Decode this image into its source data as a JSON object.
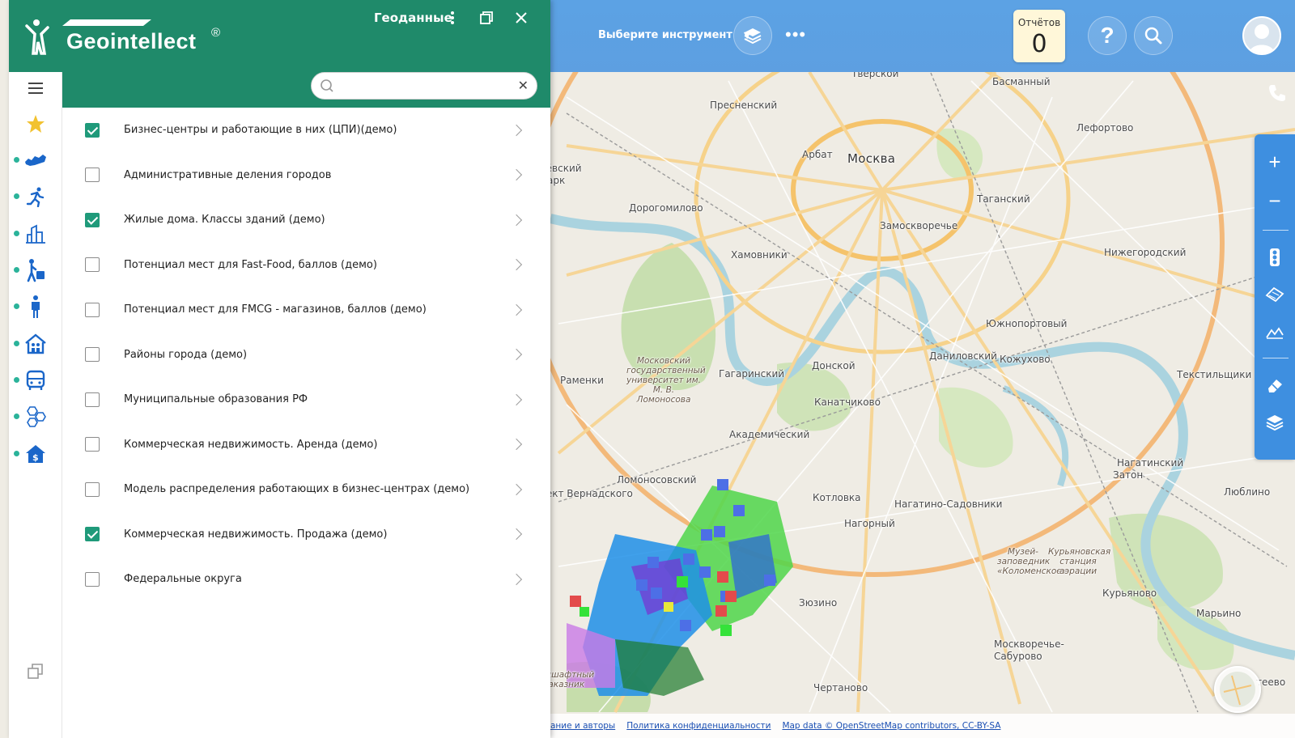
{
  "app": {
    "logo_text": "Geointellect",
    "registered_mark": "®"
  },
  "panel": {
    "title": "Геоданные",
    "search": {
      "placeholder": "",
      "value": ""
    },
    "layers": [
      {
        "label": "Бизнес-центры и работающие в них (ЦПИ)(демо)",
        "checked": true
      },
      {
        "label": "Административные деления городов",
        "checked": false
      },
      {
        "label": "Жилые дома. Классы зданий (демо)",
        "checked": true
      },
      {
        "label": "Потенциал мест для Fast-Food, баллов (демо)",
        "checked": false
      },
      {
        "label": "Потенциал мест для FMCG - магазинов, баллов (демо)",
        "checked": false
      },
      {
        "label": "Районы города (демо)",
        "checked": false
      },
      {
        "label": "Муниципальные образования РФ",
        "checked": false
      },
      {
        "label": "Коммерческая недвижимость. Аренда (демо)",
        "checked": false
      },
      {
        "label": "Модель распределения работающих в бизнес-центрах (демо)",
        "checked": false
      },
      {
        "label": "Коммерческая недвижимость. Продажа (демо)",
        "checked": true
      },
      {
        "label": "Федеральные округа",
        "checked": false
      }
    ],
    "rail_icons": [
      "menu-icon",
      "star-icon",
      "russia-map-icon",
      "running-person-icon",
      "city-buildings-icon",
      "traveler-luggage-icon",
      "standing-person-icon",
      "family-house-icon",
      "bus-icon",
      "hexagons-icon",
      "house-money-icon"
    ]
  },
  "topbar": {
    "tool_select": "Выберите инструмент",
    "reports_label": "Отчётов",
    "reports_count": "0",
    "help_glyph": "?"
  },
  "map": {
    "labels": [
      {
        "text": "Тверской",
        "kind": "district"
      },
      {
        "text": "Басманный",
        "kind": "district"
      },
      {
        "text": "Пресненский",
        "kind": "district"
      },
      {
        "text": "Лефортово",
        "kind": "district"
      },
      {
        "text": "Арбат",
        "kind": "district"
      },
      {
        "text": "Москва",
        "kind": "city"
      },
      {
        "text": "лёвский",
        "kind": "district"
      },
      {
        "text": "Парк",
        "kind": "district"
      },
      {
        "text": "Таганский",
        "kind": "district"
      },
      {
        "text": "Дорогомилово",
        "kind": "district"
      },
      {
        "text": "Замоскворечье",
        "kind": "district"
      },
      {
        "text": "Нижегородский",
        "kind": "district"
      },
      {
        "text": "Хамовники",
        "kind": "district"
      },
      {
        "text": "Южнопортовый",
        "kind": "district"
      },
      {
        "text": "Даниловский",
        "kind": "district"
      },
      {
        "text": "Кожухово",
        "kind": "district"
      },
      {
        "text": "Донской",
        "kind": "district"
      },
      {
        "text": "Гагаринский",
        "kind": "district"
      },
      {
        "text": "Текстильщики",
        "kind": "district"
      },
      {
        "text": "Раменки",
        "kind": "district"
      },
      {
        "text": "Канатчиково",
        "kind": "district"
      },
      {
        "text": "Академический",
        "kind": "district"
      },
      {
        "text": "Нагатинский",
        "kind": "district"
      },
      {
        "text": "Затон",
        "kind": "district"
      },
      {
        "text": "Ломоносовский",
        "kind": "district"
      },
      {
        "text": "пект Вернадского",
        "kind": "district"
      },
      {
        "text": "Котловка",
        "kind": "district"
      },
      {
        "text": "Нагатино-Садовники",
        "kind": "district"
      },
      {
        "text": "Люблино",
        "kind": "district"
      },
      {
        "text": "Нагорный",
        "kind": "district"
      },
      {
        "text": "Зюзино",
        "kind": "district"
      },
      {
        "text": "Курьяново",
        "kind": "district"
      },
      {
        "text": "Марьино",
        "kind": "district"
      },
      {
        "text": "Москворечье-",
        "kind": "district"
      },
      {
        "text": "Сабурово",
        "kind": "district"
      },
      {
        "text": "Чертаново",
        "kind": "district"
      },
      {
        "text": "теево",
        "kind": "district"
      }
    ],
    "italic_labels": [
      {
        "text": "Московский государственный университет им. М. В. Ломоносова"
      },
      {
        "text": "Музей- заповедник «Коломенское»"
      },
      {
        "text": "Курьяновская станция аэрации"
      },
      {
        "text": "ндшафтный заказник"
      }
    ],
    "attribution": [
      "ание и авторы",
      "Политика конфиденциальности",
      "Map data © OpenStreetMap contributors, CC-BY-SA"
    ]
  },
  "colors": {
    "panel_header": "#1f8a6a",
    "topbar": "#5ca2e4",
    "right_toolbar": "#3e8fe0",
    "check_on": "#1f9a7a"
  }
}
